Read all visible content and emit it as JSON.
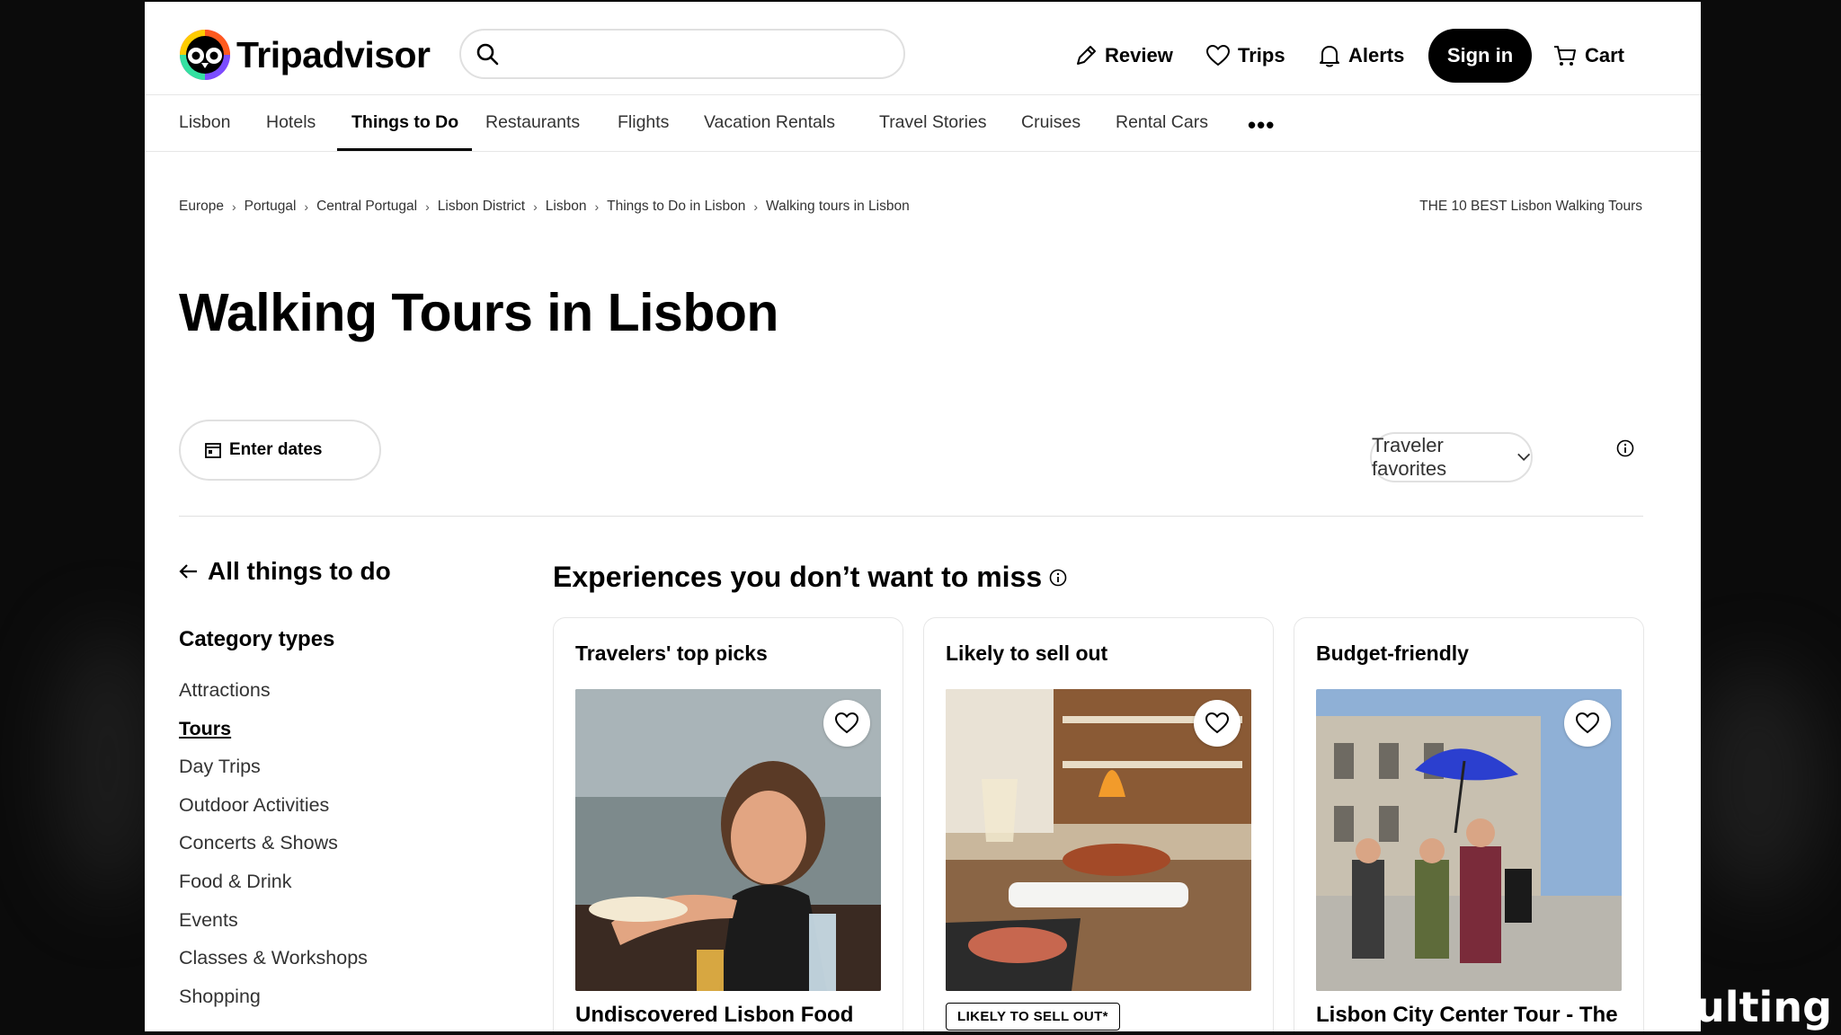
{
  "overlay_text": "sulting",
  "brand": {
    "name": "Tripadvisor",
    "accent": "#34e0a1"
  },
  "search": {
    "placeholder": "",
    "icon": "search-icon"
  },
  "header_nav": [
    {
      "label": "Review",
      "icon": "pencil-icon"
    },
    {
      "label": "Trips",
      "icon": "heart-icon"
    },
    {
      "label": "Alerts",
      "icon": "bell-icon"
    }
  ],
  "sign_in": "Sign in",
  "cart": {
    "label": "Cart",
    "icon": "cart-icon"
  },
  "tabs": [
    "Lisbon",
    "Hotels",
    "Things to Do",
    "Restaurants",
    "Flights",
    "Vacation Rentals",
    "Travel Stories",
    "Cruises",
    "Rental Cars"
  ],
  "tabs_more": "•••",
  "breadcrumb": [
    "Europe",
    "Portugal",
    "Central Portugal",
    "Lisbon District",
    "Lisbon",
    "Things to Do in Lisbon",
    "Walking tours in Lisbon"
  ],
  "breadcrumb_right": "THE 10 BEST Lisbon Walking Tours",
  "page_title": "Walking Tours in Lisbon",
  "dates_button": "Enter dates",
  "sort": {
    "label": "Traveler favorites"
  },
  "sidebar": {
    "back_link": "All things to do",
    "category_title": "Category types",
    "categories": [
      "Attractions",
      "Tours",
      "Day Trips",
      "Outdoor Activities",
      "Concerts & Shows",
      "Food & Drink",
      "Events",
      "Classes & Workshops",
      "Shopping"
    ],
    "active_category": "Tours"
  },
  "experiences": {
    "title": "Experiences you don’t want to miss",
    "cards": [
      {
        "heading": "Travelers' top picks",
        "name": "Undiscovered Lisbon Food"
      },
      {
        "heading": "Likely to sell out",
        "badge": "LIKELY TO SELL OUT*"
      },
      {
        "heading": "Budget-friendly",
        "name": "Lisbon City Center Tour - The"
      }
    ]
  }
}
